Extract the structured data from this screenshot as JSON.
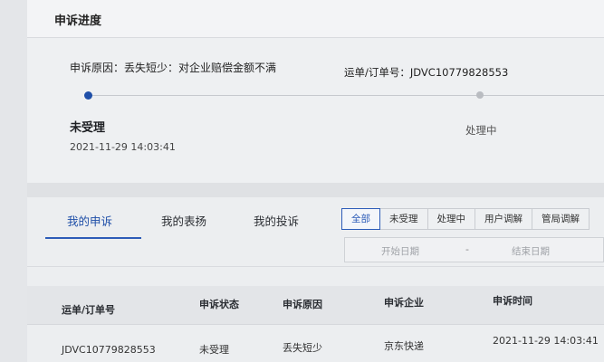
{
  "header": {
    "title": "申诉进度"
  },
  "complaint": {
    "reason_text": "申诉原因：丢失短少：对企业赔偿金额不满",
    "order_text": "运单/订单号：JDVC10779828553"
  },
  "progress": {
    "steps": [
      {
        "label": "未受理",
        "time": "2021-11-29 14:03:41",
        "active": true
      },
      {
        "label": "处理中",
        "time": "",
        "active": false
      }
    ]
  },
  "tabs": [
    {
      "label": "我的申诉",
      "active": true
    },
    {
      "label": "我的表扬",
      "active": false
    },
    {
      "label": "我的投诉",
      "active": false
    }
  ],
  "filters": [
    {
      "label": "全部",
      "active": true
    },
    {
      "label": "未受理",
      "active": false
    },
    {
      "label": "处理中",
      "active": false
    },
    {
      "label": "用户调解",
      "active": false
    },
    {
      "label": "管局调解",
      "active": false
    }
  ],
  "date_range": {
    "start_placeholder": "开始日期",
    "separator": "-",
    "end_placeholder": "结束日期"
  },
  "table": {
    "headers": [
      "运单/订单号",
      "申诉状态",
      "申诉原因",
      "申诉企业",
      "申诉时间"
    ],
    "rows": [
      [
        "JDVC10779828553",
        "未受理",
        "丢失短少",
        "京东快递",
        "2021-11-29 14:03:41"
      ]
    ]
  },
  "colors": {
    "accent": "#1f4fa8",
    "background": "#e4e6e9"
  }
}
